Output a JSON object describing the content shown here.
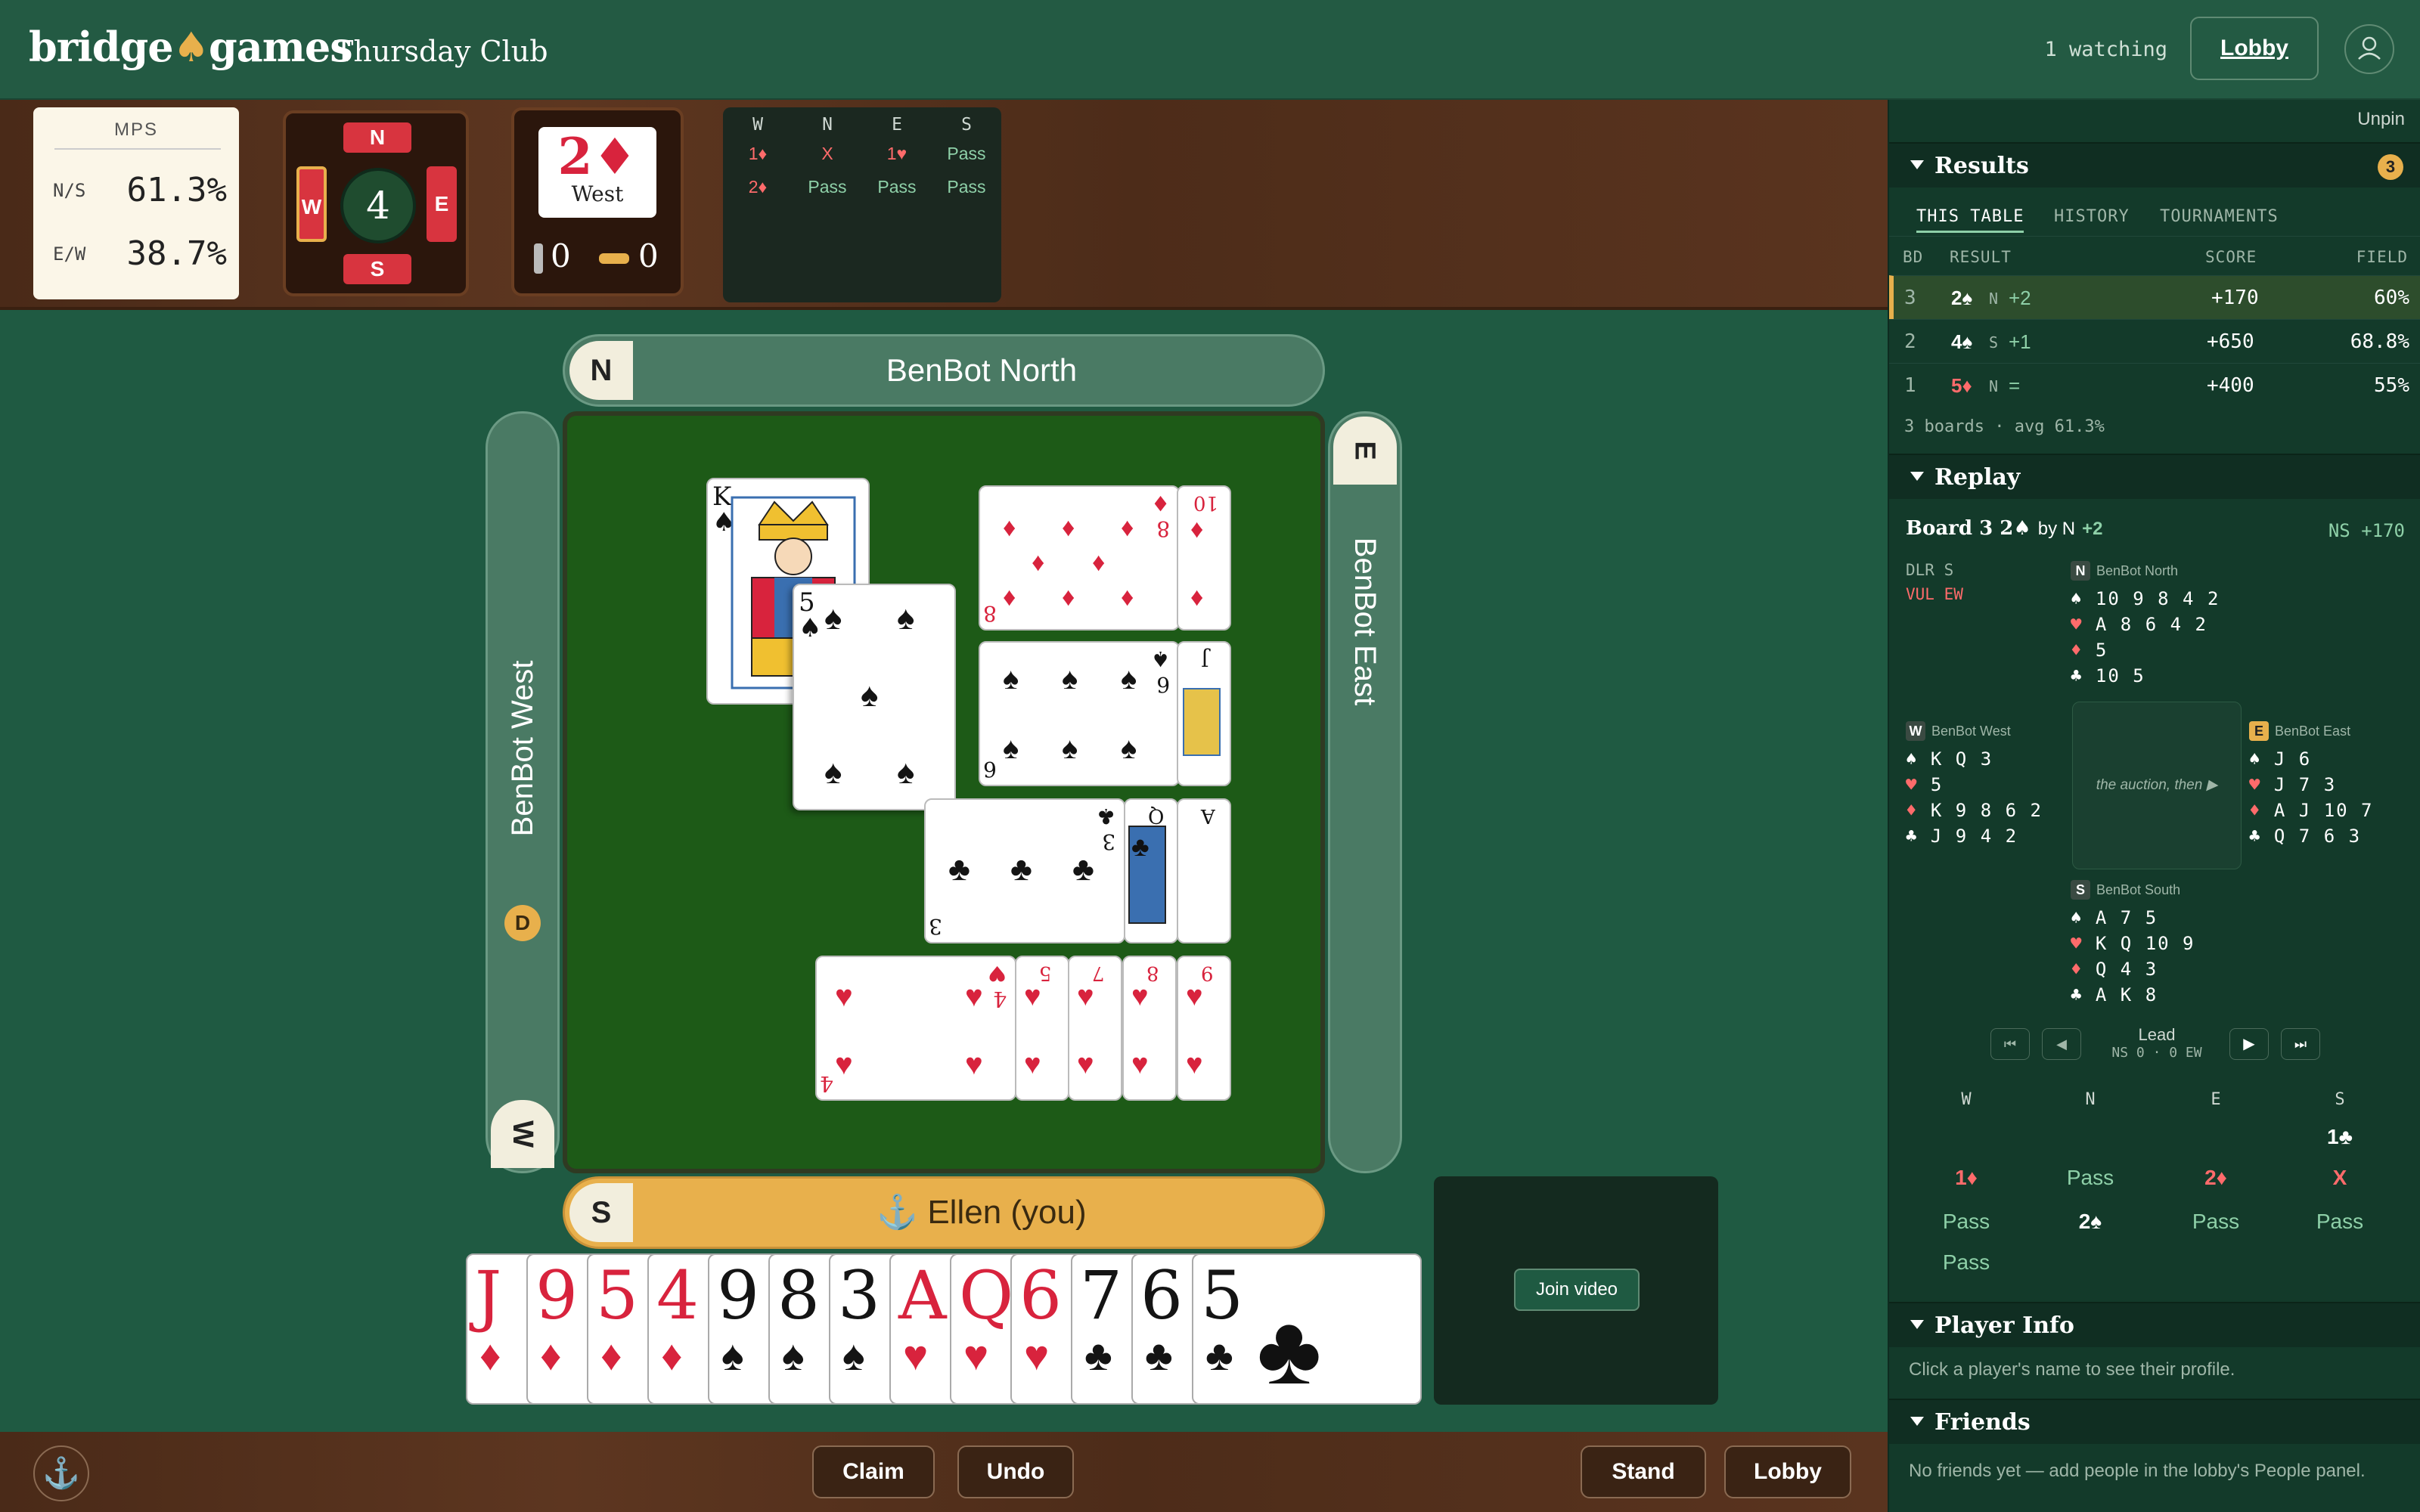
{
  "header": {
    "logo_left": "bridge",
    "logo_suit": "♠",
    "logo_right": "games",
    "club": "Thursday Club",
    "watching": "1 watching",
    "lobby": "Lobby"
  },
  "mps": {
    "title": "MPS",
    "ns_label": "N/S",
    "ns_value": "61.3%",
    "ew_label": "E/W",
    "ew_value": "38.7%"
  },
  "compass": {
    "n": "N",
    "s": "S",
    "e": "E",
    "w": "W",
    "board": "4"
  },
  "contract": {
    "level": "2♦",
    "declarer": "West",
    "tricks_ns": "0",
    "tricks_ew": "0"
  },
  "auction_mini": {
    "headers": [
      "W",
      "N",
      "E",
      "S"
    ],
    "rows": [
      [
        "1♦",
        "X",
        "1♥",
        "Pass"
      ],
      [
        "2♦",
        "Pass",
        "Pass",
        "Pass"
      ]
    ]
  },
  "table": {
    "north_letter": "N",
    "north_name": "BenBot North",
    "west_name": "BenBot West",
    "west_letter": "W",
    "east_name": "BenBot East",
    "east_letter": "E",
    "south_letter": "S",
    "south_name": "⚓ Ellen (you)",
    "dealer_badge": "D"
  },
  "trick_cards": {
    "north_played": "K♠",
    "center_played": "5♠"
  },
  "dummy": {
    "diamonds": [
      "8",
      "10"
    ],
    "spades": [
      "6",
      "J"
    ],
    "clubs": [
      "3",
      "Q",
      "A"
    ],
    "hearts": [
      "4",
      "5",
      "7",
      "8",
      "9"
    ]
  },
  "hand": [
    {
      "rank": "J",
      "suit": "♦",
      "color": "red"
    },
    {
      "rank": "9",
      "suit": "♦",
      "color": "red"
    },
    {
      "rank": "5",
      "suit": "♦",
      "color": "red"
    },
    {
      "rank": "4",
      "suit": "♦",
      "color": "red"
    },
    {
      "rank": "9",
      "suit": "♠",
      "color": "black"
    },
    {
      "rank": "8",
      "suit": "♠",
      "color": "black"
    },
    {
      "rank": "3",
      "suit": "♠",
      "color": "black"
    },
    {
      "rank": "A",
      "suit": "♥",
      "color": "red"
    },
    {
      "rank": "Q",
      "suit": "♥",
      "color": "red"
    },
    {
      "rank": "6",
      "suit": "♥",
      "color": "red"
    },
    {
      "rank": "7",
      "suit": "♣",
      "color": "black"
    },
    {
      "rank": "6",
      "suit": "♣",
      "color": "black"
    },
    {
      "rank": "5",
      "suit": "♣",
      "color": "black"
    }
  ],
  "video": {
    "join": "Join video"
  },
  "bottom": {
    "claim": "Claim",
    "undo": "Undo",
    "stand": "Stand",
    "lobby": "Lobby"
  },
  "sidebar": {
    "unpin": "Unpin",
    "results_title": "Results",
    "results_count": "3",
    "tabs": [
      "THIS TABLE",
      "HISTORY",
      "TOURNAMENTS"
    ],
    "cols": [
      "BD",
      "RESULT",
      "SCORE",
      "FIELD"
    ],
    "rows": [
      {
        "bd": "3",
        "contract": "2♠",
        "by": "N",
        "res": "+2",
        "score": "+170",
        "field": "60%"
      },
      {
        "bd": "2",
        "contract": "4♠",
        "by": "S",
        "res": "+1",
        "score": "+650",
        "field": "68.8%"
      },
      {
        "bd": "1",
        "contract": "5♦",
        "by": "N",
        "res": "=",
        "score": "+400",
        "field": "55%"
      }
    ],
    "summary": "3 boards · avg 61.3%",
    "replay_title": "Replay",
    "replay_board": "Board 3",
    "replay_contract": "2♠",
    "replay_by": "by N",
    "replay_res": "+2",
    "replay_score": "NS +170",
    "dlr": "DLR S",
    "vul": "VUL EW",
    "north": {
      "badge": "N",
      "name": "BenBot North",
      "s": "10 9 8 4 2",
      "h": "A 8 6 4 2",
      "d": "5",
      "c": "10 5"
    },
    "west": {
      "badge": "W",
      "name": "BenBot West",
      "s": "K Q 3",
      "h": "5",
      "d": "K 9 8 6 2",
      "c": "J 9 4 2"
    },
    "east": {
      "badge": "E",
      "name": "BenBot East",
      "s": "J 6",
      "h": "J 7 3",
      "d": "A J 10 7",
      "c": "Q 7 6 3"
    },
    "south": {
      "badge": "S",
      "name": "BenBot South",
      "s": "A 7 5",
      "h": "K Q 10 9",
      "d": "Q 4 3",
      "c": "A K 8"
    },
    "center_text": "the auction, then ▶",
    "lead_label": "Lead",
    "lead_sub": "NS 0 · 0 EW",
    "bid_headers": [
      "W",
      "N",
      "E",
      "S"
    ],
    "bids": [
      [
        "",
        "",
        "",
        "1♣"
      ],
      [
        "1♦",
        "Pass",
        "2♦",
        "X"
      ],
      [
        "Pass",
        "2♠",
        "Pass",
        "Pass"
      ],
      [
        "Pass",
        "",
        "",
        ""
      ]
    ],
    "player_info_title": "Player Info",
    "player_info_text": "Click a player's name to see their profile.",
    "friends_title": "Friends",
    "friends_text": "No friends yet — add people in the lobby's People panel."
  },
  "colors": {
    "felt": "#1d5a17",
    "accent": "#e8b04c",
    "red_suit": "#d8233d",
    "header": "#235a43"
  }
}
